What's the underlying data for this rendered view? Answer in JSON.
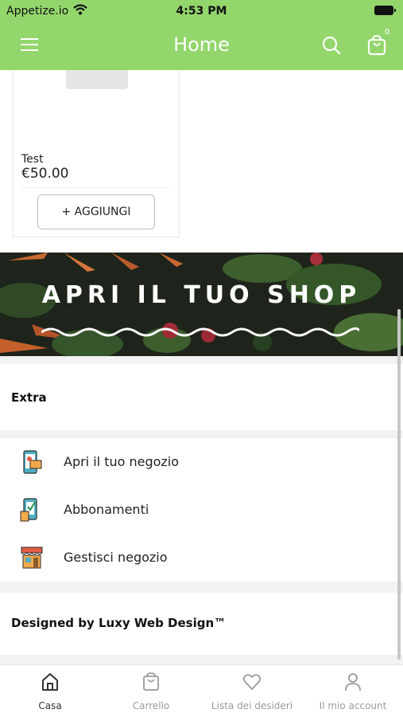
{
  "status_bar": {
    "carrier": "Appetize.io",
    "time": "4:53 PM"
  },
  "header": {
    "title": "Home",
    "cart_count": "0"
  },
  "product": {
    "name": "Test",
    "price": "€50.00",
    "add_label": "+ AGGIUNGI"
  },
  "banner": {
    "text": "APRI IL TUO SHOP"
  },
  "extra": {
    "title": "Extra",
    "items": [
      {
        "label": "Apri il tuo negozio",
        "icon": "open-shop-icon"
      },
      {
        "label": "Abbonamenti",
        "icon": "subscriptions-icon"
      },
      {
        "label": "Gestisci negozio",
        "icon": "manage-shop-icon"
      }
    ]
  },
  "footer": {
    "credit": "Designed by Luxy Web Design™"
  },
  "tabs": [
    {
      "label": "Casa",
      "icon": "home-icon",
      "active": true
    },
    {
      "label": "Carrello",
      "icon": "cart-icon",
      "active": false
    },
    {
      "label": "Lista dei desideri",
      "icon": "heart-icon",
      "active": false
    },
    {
      "label": "Il mio account",
      "icon": "user-icon",
      "active": false
    }
  ],
  "colors": {
    "accent": "#93d66c",
    "tab_inactive": "#9a9a9a"
  }
}
